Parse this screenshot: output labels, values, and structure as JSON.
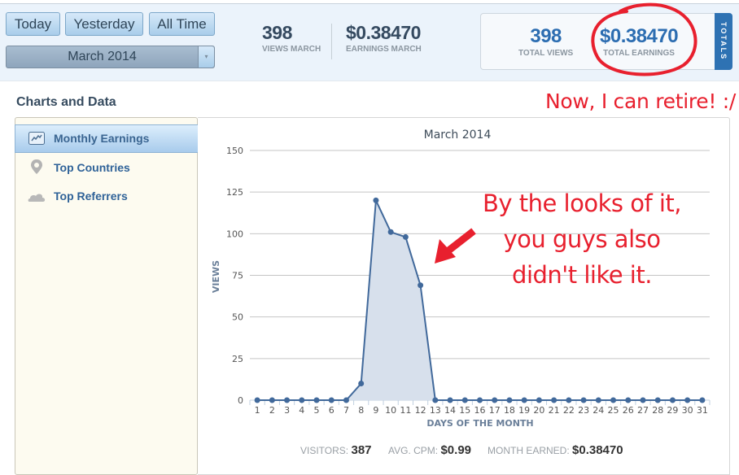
{
  "header": {
    "buttons": {
      "today": "Today",
      "yesterday": "Yesterday",
      "all_time": "All Time"
    },
    "month_select": {
      "value": "March 2014",
      "arrow_icon": "▾"
    },
    "month_stats": {
      "views": {
        "value": "398",
        "label": "VIEWS MARCH"
      },
      "earnings": {
        "value": "$0.38470",
        "label": "EARNINGS MARCH"
      }
    },
    "totals": {
      "views": {
        "value": "398",
        "label": "TOTAL VIEWS"
      },
      "earnings": {
        "value": "$0.38470",
        "label": "TOTAL EARNINGS"
      },
      "tab_label": "TOTALS"
    }
  },
  "section_title": "Charts and Data",
  "sidebar": {
    "items": [
      {
        "label": "Monthly Earnings",
        "icon": "line-chart-icon",
        "active": true
      },
      {
        "label": "Top Countries",
        "icon": "map-pin-icon",
        "active": false
      },
      {
        "label": "Top Referrers",
        "icon": "cloud-icon",
        "active": false
      }
    ]
  },
  "annotations": {
    "retire": "Now, I can retire! :/",
    "chart_note": [
      "By the looks of it,",
      "you guys also",
      "didn't like it."
    ],
    "colors": {
      "annotation_red": "#e8202e"
    }
  },
  "chart_data": {
    "type": "area",
    "title": "March 2014",
    "xlabel": "DAYS OF THE MONTH",
    "ylabel": "VIEWS",
    "x": [
      1,
      2,
      3,
      4,
      5,
      6,
      7,
      8,
      9,
      10,
      11,
      12,
      13,
      14,
      15,
      16,
      17,
      18,
      19,
      20,
      21,
      22,
      23,
      24,
      25,
      26,
      27,
      28,
      29,
      30,
      31
    ],
    "series": [
      {
        "name": "Views",
        "values": [
          0,
          0,
          0,
          0,
          0,
          0,
          0,
          10,
          120,
          101,
          98,
          69,
          0,
          0,
          0,
          0,
          0,
          0,
          0,
          0,
          0,
          0,
          0,
          0,
          0,
          0,
          0,
          0,
          0,
          0,
          0
        ],
        "color": "#41699b",
        "fill": "#d7e0ec"
      }
    ],
    "ylim": [
      0,
      150
    ],
    "yticks": [
      0,
      25,
      50,
      75,
      100,
      125,
      150
    ],
    "grid": true,
    "legend": "none"
  },
  "footer": {
    "visitors": {
      "label": "VISITORS:",
      "value": "387"
    },
    "avg_cpm": {
      "label": "AVG. CPM:",
      "value": "$0.99"
    },
    "month_earned": {
      "label": "MONTH EARNED:",
      "value": "$0.38470"
    }
  }
}
